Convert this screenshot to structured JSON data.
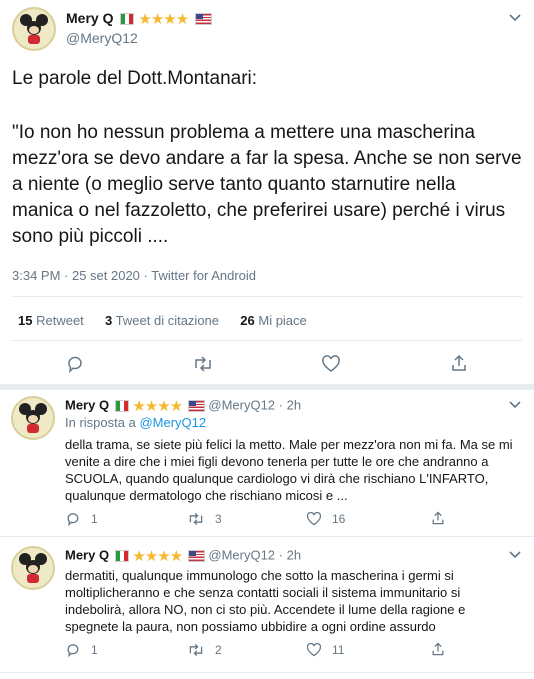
{
  "main_tweet": {
    "author_name": "Mery Q",
    "handle": "@MeryQ12",
    "stars": "★★★★",
    "text_line1": "Le parole del Dott.Montanari:",
    "text_quote": "\"Io non ho nessun problema a mettere una mascherina mezz'ora se devo andare a far la spesa. Anche se non serve a niente (o meglio serve tanto quanto starnutire nella manica o nel fazzoletto, che preferirei usare) perché i virus sono più piccoli ....",
    "timestamp": "3:34 PM · 25 set 2020 · Twitter for Android",
    "retweets_count": "15",
    "retweets_label": "Retweet",
    "quotes_count": "3",
    "quotes_label": "Tweet di citazione",
    "likes_count": "26",
    "likes_label": "Mi piace"
  },
  "replies": [
    {
      "author_name": "Mery Q",
      "stars": "★★★★",
      "handle": "@MeryQ12",
      "time": "· 2h",
      "replying_to_prefix": "In risposta a",
      "replying_to_handle": "@MeryQ12",
      "text": "della trama, se siete più felici la metto. Male per mezz'ora non mi fa. Ma se mi venite a dire che i miei figli devono tenerla per tutte le ore che andranno a SCUOLA, quando qualunque cardiologo vi dirà che rischiano L'INFARTO, qualunque dermatologo che rischiano micosi e ...",
      "replies_count": "1",
      "retweets_count": "3",
      "likes_count": "16"
    },
    {
      "author_name": "Mery Q",
      "stars": "★★★★",
      "handle": "@MeryQ12",
      "time": "· 2h",
      "text": "dermatiti, qualunque immunologo che sotto la mascherina i germi si moltiplicheranno e che senza contatti sociali il sistema immunitario si indebolirà, allora NO, non ci sto più. Accendete il lume della ragione e spegnete la paura, non possiamo ubbidire a ogni ordine assurdo",
      "replies_count": "1",
      "retweets_count": "2",
      "likes_count": "11"
    }
  ]
}
